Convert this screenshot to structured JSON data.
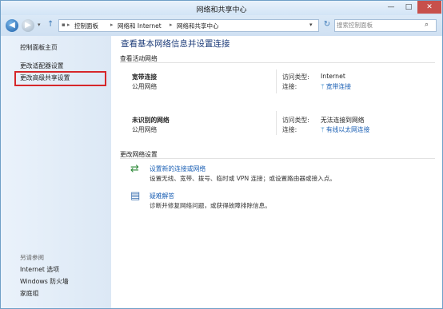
{
  "window": {
    "title": "网络和共享中心",
    "min_glyph": "—",
    "max_glyph": "□",
    "close_glyph": "✕"
  },
  "address_bar": {
    "breadcrumb": [
      "控制面板",
      "网络和 Internet",
      "网络和共享中心"
    ],
    "search_placeholder": "搜索控制面板"
  },
  "sidebar": {
    "items": [
      {
        "label": "控制面板主页"
      },
      {
        "label": "更改适配器设置"
      },
      {
        "label": "更改高级共享设置"
      }
    ],
    "see_also_heading": "另请参阅",
    "see_also": [
      {
        "label": "Internet 选项"
      },
      {
        "label": "Windows 防火墙"
      },
      {
        "label": "家庭组"
      }
    ]
  },
  "main": {
    "title": "查看基本网络信息并设置连接",
    "active_networks_heading": "查看活动网络",
    "networks": [
      {
        "name": "宽带连接",
        "type": "公用网络",
        "access_label": "访问类型:",
        "access_value": "Internet",
        "connection_label": "连接:",
        "connection_value": "宽带连接"
      },
      {
        "name": "未识别的网络",
        "type": "公用网络",
        "access_label": "访问类型:",
        "access_value": "无法连接到网络",
        "connection_label": "连接:",
        "connection_value": "有线以太网连接"
      }
    ],
    "change_settings_heading": "更改网络设置",
    "tasks": [
      {
        "link": "设置新的连接或网络",
        "desc": "设置无线、宽带、拨号、临时或 VPN 连接；或设置路由器或接入点。"
      },
      {
        "link": "疑难解答",
        "desc": "诊断并修复网络问题，或获得故障排除信息。"
      }
    ]
  }
}
